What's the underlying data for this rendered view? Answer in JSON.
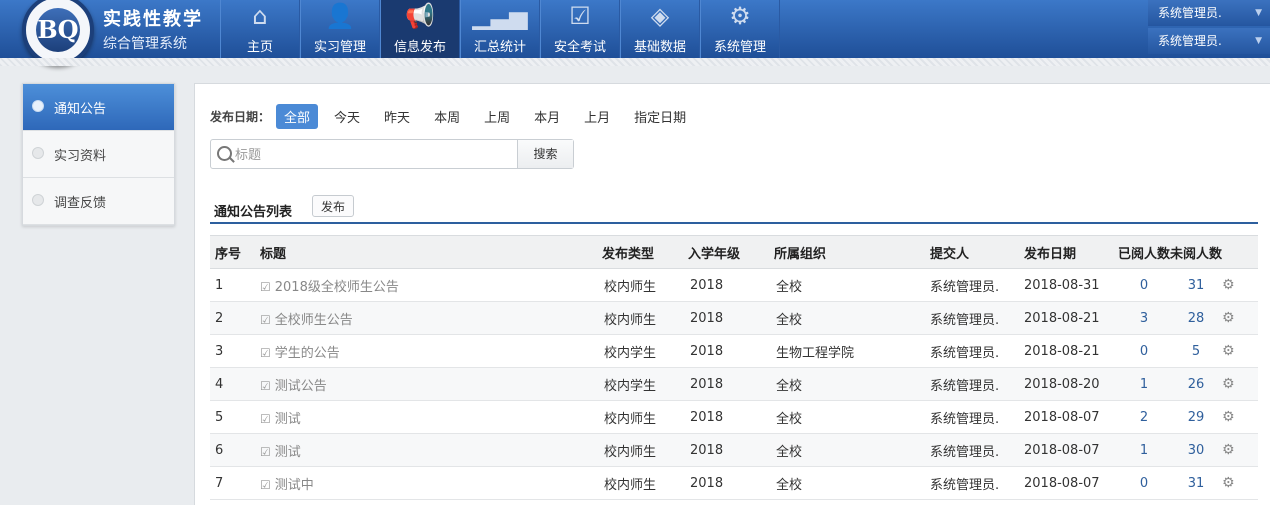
{
  "app": {
    "title": "实践性教学",
    "subtitle": "综合管理系统",
    "logo_text": "BQ"
  },
  "nav": {
    "items": [
      {
        "label": "主页",
        "icon": "home-icon",
        "glyph": "⌂",
        "active": false
      },
      {
        "label": "实习管理",
        "icon": "user-icon",
        "glyph": "👤",
        "active": false
      },
      {
        "label": "信息发布",
        "icon": "megaphone-icon",
        "glyph": "📢",
        "active": true
      },
      {
        "label": "汇总统计",
        "icon": "bar-chart-icon",
        "glyph": "▁▃▅",
        "active": false
      },
      {
        "label": "安全考试",
        "icon": "clipboard-check-icon",
        "glyph": "☑",
        "active": false
      },
      {
        "label": "基础数据",
        "icon": "layers-icon",
        "glyph": "◈",
        "active": false
      },
      {
        "label": "系统管理",
        "icon": "gear-icon",
        "glyph": "⚙",
        "active": false
      }
    ]
  },
  "user": {
    "top": "系统管理员.",
    "bottom": "系统管理员.",
    "arrow": "▼"
  },
  "sidebar": {
    "items": [
      {
        "label": "通知公告",
        "active": true
      },
      {
        "label": "实习资料",
        "active": false
      },
      {
        "label": "调查反馈",
        "active": false
      }
    ]
  },
  "filter": {
    "label": "发布日期：",
    "options": [
      "全部",
      "今天",
      "昨天",
      "本周",
      "上周",
      "本月",
      "上月",
      "指定日期"
    ],
    "active": "全部"
  },
  "search": {
    "placeholder": "标题",
    "value": "",
    "button": "搜索"
  },
  "list": {
    "title": "通知公告列表",
    "publish_button": "发布"
  },
  "table": {
    "columns": [
      "序号",
      "标题",
      "发布类型",
      "入学年级",
      "所属组织",
      "提交人",
      "发布日期",
      "已阅人数",
      "未阅人数"
    ],
    "rows": [
      {
        "no": "1",
        "title": "2018级全校师生公告",
        "type": "校内师生",
        "grade": "2018",
        "org": "全校",
        "submitter": "系统管理员.",
        "date": "2018-08-31",
        "read": "0",
        "unread": "31"
      },
      {
        "no": "2",
        "title": "全校师生公告",
        "type": "校内师生",
        "grade": "2018",
        "org": "全校",
        "submitter": "系统管理员.",
        "date": "2018-08-21",
        "read": "3",
        "unread": "28"
      },
      {
        "no": "3",
        "title": "学生的公告",
        "type": "校内学生",
        "grade": "2018",
        "org": "生物工程学院",
        "submitter": "系统管理员.",
        "date": "2018-08-21",
        "read": "0",
        "unread": "5"
      },
      {
        "no": "4",
        "title": "测试公告",
        "type": "校内学生",
        "grade": "2018",
        "org": "全校",
        "submitter": "系统管理员.",
        "date": "2018-08-20",
        "read": "1",
        "unread": "26"
      },
      {
        "no": "5",
        "title": "测试",
        "type": "校内师生",
        "grade": "2018",
        "org": "全校",
        "submitter": "系统管理员.",
        "date": "2018-08-07",
        "read": "2",
        "unread": "29"
      },
      {
        "no": "6",
        "title": "测试",
        "type": "校内师生",
        "grade": "2018",
        "org": "全校",
        "submitter": "系统管理员.",
        "date": "2018-08-07",
        "read": "1",
        "unread": "30"
      },
      {
        "no": "7",
        "title": "测试中",
        "type": "校内师生",
        "grade": "2018",
        "org": "全校",
        "submitter": "系统管理员.",
        "date": "2018-08-07",
        "read": "0",
        "unread": "31"
      }
    ]
  },
  "icons": {
    "row_check": "☑",
    "row_gear": "⚙"
  },
  "colors": {
    "header_top": "#3c78c8",
    "header_bottom": "#1f4f98",
    "accent": "#4b8ad6",
    "count_link": "#2f5f9c"
  }
}
